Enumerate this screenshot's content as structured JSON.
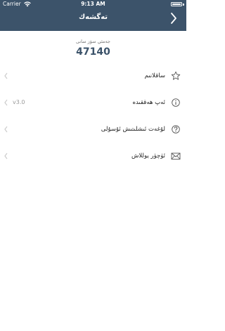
{
  "status_bar": {
    "carrier": "Carrier",
    "time": "9:13 AM",
    "battery_level": 1.0
  },
  "nav": {
    "title": "تەگشەك"
  },
  "stats": {
    "label": "جەمئي سۆز سانى",
    "value": "47140"
  },
  "menu": [
    {
      "label": "ساقلانىم",
      "icon": "star-icon",
      "value": ""
    },
    {
      "label": "ئەپ ھەققىدە",
      "icon": "info-icon",
      "value": "v3.0"
    },
    {
      "label": "لۇغەت ئىشلىتىش ئۇسۇلى",
      "icon": "help-icon",
      "value": ""
    },
    {
      "label": "ئۈچۈر يوللاش",
      "icon": "mail-icon",
      "value": ""
    }
  ],
  "colors": {
    "header_bg": "#3c536a",
    "accent_text": "#3c536a",
    "chevron": "#cccccc",
    "icon": "#555555"
  }
}
